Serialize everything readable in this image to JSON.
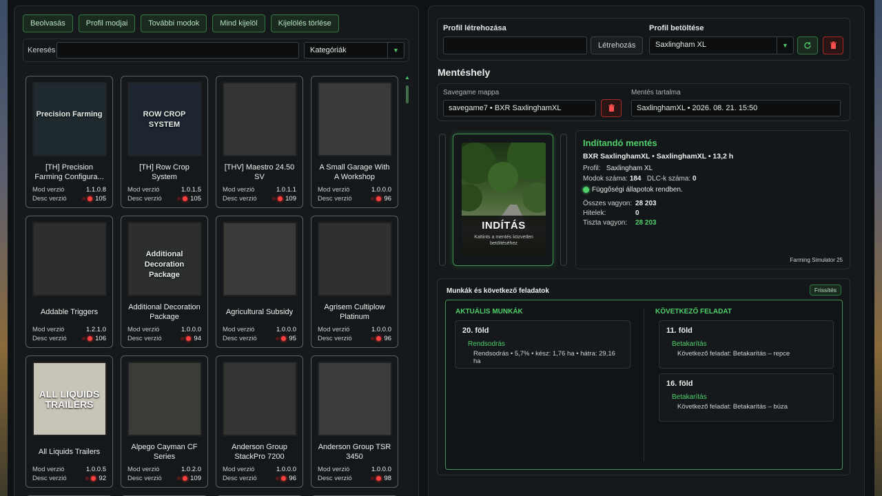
{
  "toolbar": {
    "scan": "Beolvasás",
    "profile_mods": "Profil modjai",
    "more_mods": "További modok",
    "select_all": "Mind kijelöl",
    "clear_selection": "Kijelölés törlése"
  },
  "search": {
    "label": "Keresés",
    "value": "",
    "category": "Kategóriák"
  },
  "mod_labels": {
    "version": "Mod verzió",
    "desc": "Desc verzió"
  },
  "mods": [
    {
      "title": "[TH] Precision Farming Configura...",
      "version": "1.1.0.8",
      "desc": "105",
      "thumb_text": "Precision Farming"
    },
    {
      "title": "[TH] Row Crop System",
      "version": "1.0.1.5",
      "desc": "105",
      "thumb_text": "ROW CROP SYSTEM"
    },
    {
      "title": "[THV] Maestro 24.50 SV",
      "version": "1.0.1.1",
      "desc": "109",
      "thumb_text": ""
    },
    {
      "title": "A Small Garage With A Workshop",
      "version": "1.0.0.0",
      "desc": "96",
      "thumb_text": ""
    },
    {
      "title": "Addable Triggers",
      "version": "1.2.1.0",
      "desc": "106",
      "thumb_text": ""
    },
    {
      "title": "Additional Decoration Package",
      "version": "1.0.0.0",
      "desc": "94",
      "thumb_text": "Additional Decoration Package"
    },
    {
      "title": "Agricultural Subsidy",
      "version": "1.0.0.0",
      "desc": "95",
      "thumb_text": ""
    },
    {
      "title": "Agrisem Cultiplow Platinum",
      "version": "1.0.0.0",
      "desc": "96",
      "thumb_text": ""
    },
    {
      "title": "All Liquids Trailers",
      "version": "1.0.0.5",
      "desc": "92",
      "thumb_text": "ALL LIQUIDS TRAILERS"
    },
    {
      "title": "Alpego Cayman CF Series",
      "version": "1.0.2.0",
      "desc": "109",
      "thumb_text": ""
    },
    {
      "title": "Anderson Group StackPro 7200",
      "version": "1.0.0.0",
      "desc": "96",
      "thumb_text": ""
    },
    {
      "title": "Anderson Group TSR 3450",
      "version": "1.0.0.0",
      "desc": "98",
      "thumb_text": ""
    }
  ],
  "profile": {
    "create_label": "Profil létrehozása",
    "create_value": "",
    "create_button": "Létrehozás",
    "load_label": "Profil betöltése",
    "selected": "Saxlingham XL"
  },
  "save": {
    "section_title": "Mentéshely",
    "folder_label": "Savegame mappa",
    "folder_value": "savegame7 • BXR SaxlinghamXL",
    "content_label": "Mentés tartalma",
    "content_value": "SaxlinghamXL • 2026. 08. 21. 15:50"
  },
  "launch": {
    "title": "INDÍTÁS",
    "hint": "Kattints a mentés közvetlen betöltéséhez"
  },
  "info": {
    "heading": "Indítandó mentés",
    "subtitle": "BXR SaxlinghamXL • SaxlinghamXL • 13,2 h",
    "profile_label": "Profil:",
    "profile_value": "Saxlingham XL",
    "mods_label": "Modok száma:",
    "mods_value": "184",
    "dlc_label": "DLC-k száma:",
    "dlc_value": "0",
    "deps_status": "Függőségi állapotok rendben.",
    "assets_label": "Összes vagyon:",
    "assets_value": "28 203",
    "loans_label": "Hitelek:",
    "loans_value": "0",
    "net_label": "Tiszta vagyon:",
    "net_value": "28 203",
    "game": "Farming Simulator 25"
  },
  "jobs": {
    "title": "Munkák és következő feladatok",
    "refresh": "Frissítés",
    "current_heading": "AKTUÁLIS MUNKÁK",
    "next_heading": "KÖVETKEZŐ FELADAT",
    "current": [
      {
        "field": "20. föld",
        "category": "Rendsodrás",
        "detail": "Rendsodrás • 5,7% • kész: 1,76 ha • hátra: 29,16 ha"
      }
    ],
    "next": [
      {
        "field": "11. föld",
        "category": "Betakarítás",
        "detail": "Következő feladat: Betakarítás – repce"
      },
      {
        "field": "16. föld",
        "category": "Betakarítás",
        "detail": "Következő feladat: Betakarítás – búza"
      }
    ]
  },
  "colors": {
    "accent": "#4fd06a",
    "danger": "#ff4040",
    "panel": "#16191b"
  }
}
